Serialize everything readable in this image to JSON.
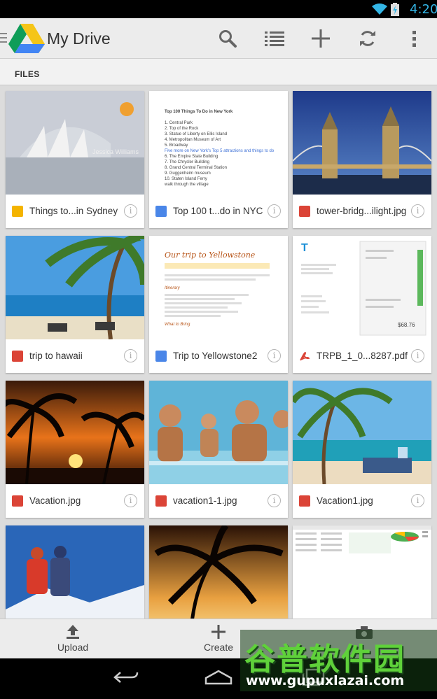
{
  "status": {
    "time": "4:20",
    "accent": "#33b5e5"
  },
  "actionbar": {
    "title": "My Drive",
    "icons": [
      "search-icon",
      "list-view-icon",
      "add-icon",
      "refresh-icon",
      "overflow-menu-icon"
    ]
  },
  "section_header": "FILES",
  "files": [
    {
      "name": "Things to...in Sydney",
      "type": "slides",
      "type_color": "#f4b400"
    },
    {
      "name": "Top 100 t...do in NYC",
      "type": "document",
      "type_color": "#4a86e8",
      "preview_title": "Top 100 Things To Do in New York",
      "preview_lines": [
        "1. Central Park",
        "2. Top of the Rock",
        "3. Statue of Liberty on Ellis Island",
        "4. Metropolitan Museum of Art",
        "5. Broadway",
        "Five more on New York's Top 5 attractions and things to do",
        "6. The Empire State Building",
        "7. The Chrysler Building",
        "8. Grand Central Terminal Station",
        "9. Guggenheim museum",
        "10. Staten Island Ferry",
        "walk through the village"
      ]
    },
    {
      "name": "tower-bridg...ilight.jpg",
      "type": "image",
      "type_color": "#db4437"
    },
    {
      "name": "trip to hawaii",
      "type": "image",
      "type_color": "#db4437"
    },
    {
      "name": "Trip to Yellowstone2",
      "type": "document",
      "type_color": "#4a86e8",
      "preview_title": "Our trip to Yellowstone",
      "preview_subhead": "Itinerary",
      "preview_footer": "What to Bring"
    },
    {
      "name": "TRPB_1_0...8287.pdf",
      "type": "pdf",
      "type_color": "#db4437",
      "preview_total": "$68.76"
    },
    {
      "name": "Vacation.jpg",
      "type": "image",
      "type_color": "#db4437"
    },
    {
      "name": "vacation1-1.jpg",
      "type": "image",
      "type_color": "#db4437"
    },
    {
      "name": "Vacation1.jpg",
      "type": "image",
      "type_color": "#db4437"
    },
    {
      "name": "",
      "type": "image",
      "type_color": "#db4437"
    },
    {
      "name": "",
      "type": "image",
      "type_color": "#db4437"
    },
    {
      "name": "",
      "type": "spreadsheet",
      "type_color": "#0f9d58"
    }
  ],
  "bottombar": {
    "upload_label": "Upload",
    "create_label": "Create",
    "camera_icon": "camera-icon"
  },
  "navbar": {
    "icons": [
      "back-icon",
      "home-icon",
      "recent-apps-icon"
    ]
  },
  "watermark": {
    "text": "谷普软件园",
    "url": "www.gupuxlazai.com"
  }
}
